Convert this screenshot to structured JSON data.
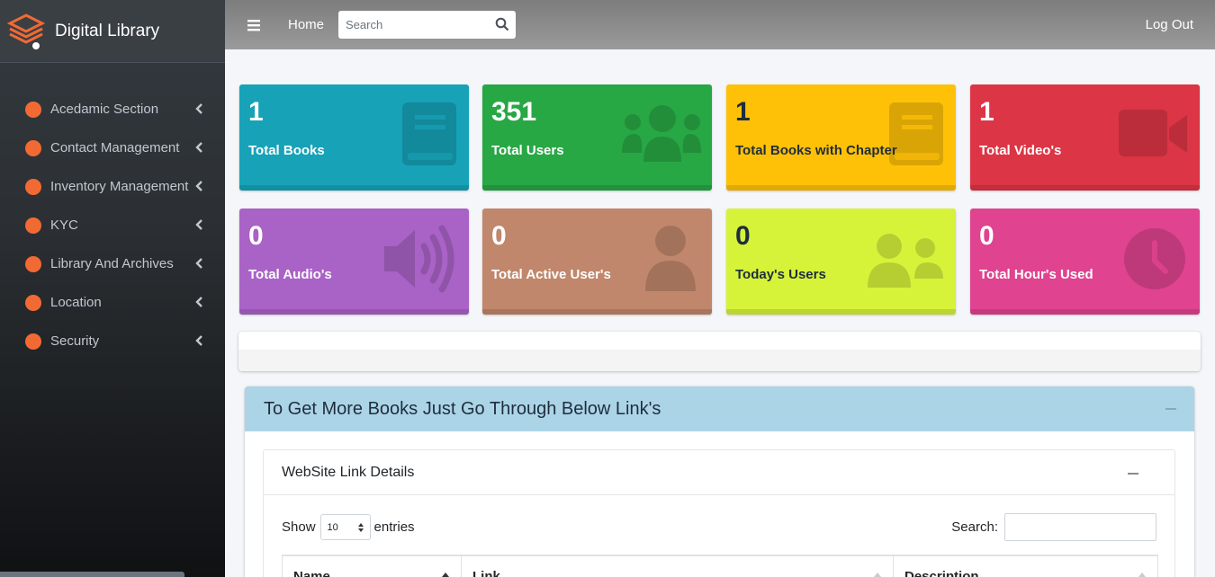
{
  "brand": {
    "name": "Digital Library",
    "logo_icon": "books-stack-icon",
    "accent": "#f26a33"
  },
  "sidebar": {
    "items": [
      {
        "label": "Acedamic Section"
      },
      {
        "label": "Contact Management"
      },
      {
        "label": "Inventory Management"
      },
      {
        "label": "KYC"
      },
      {
        "label": "Library And Archives"
      },
      {
        "label": "Location"
      },
      {
        "label": "Security"
      }
    ]
  },
  "topbar": {
    "home_label": "Home",
    "search_placeholder": "Search",
    "logout_label": "Log Out"
  },
  "stats": [
    {
      "value": "1",
      "label": "Total Books",
      "color": "#17a2b8",
      "icon": "book-icon"
    },
    {
      "value": "351",
      "label": "Total Users",
      "color": "#28a745",
      "icon": "users-icon"
    },
    {
      "value": "1",
      "label": "Total Books with Chapter",
      "color": "#ffc107",
      "icon": "book-icon"
    },
    {
      "value": "1",
      "label": "Total Video's",
      "color": "#dc3545",
      "icon": "video-camera-icon"
    },
    {
      "value": "0",
      "label": "Total Audio's",
      "color": "#a962c6",
      "icon": "volume-icon"
    },
    {
      "value": "0",
      "label": "Total Active User's",
      "color": "#c0876c",
      "icon": "user-icon"
    },
    {
      "value": "0",
      "label": "Today's Users",
      "color": "#d6f33a",
      "icon": "user-friends-icon"
    },
    {
      "value": "0",
      "label": "Total Hour's Used",
      "color": "#e0438f",
      "icon": "clock-icon"
    }
  ],
  "panel": {
    "title": "To Get More Books Just Go Through Below Link's",
    "header_color": "#acd4e7",
    "card_title": "WebSite Link Details",
    "show_label": "Show",
    "entries_label": "entries",
    "page_length": "10",
    "search_label": "Search:",
    "columns": [
      "Name",
      "Link",
      "Description"
    ]
  }
}
